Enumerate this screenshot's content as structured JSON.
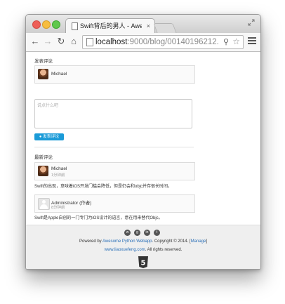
{
  "browser": {
    "tab_title": "Swift背后的男人 - Awesome",
    "tab_close": "×",
    "url_host": "localhost",
    "url_rest": ":9000/blog/00140196212...",
    "nav": {
      "back": "←",
      "forward": "→",
      "reload": "↻",
      "home": "⌂"
    },
    "zoom": "⚲",
    "star": "☆"
  },
  "page": {
    "post_comment_title": "发表评论",
    "current_user": "Michael",
    "textarea_placeholder": "说点什么吧",
    "submit_label": "发表评论",
    "latest_comments_title": "最新评论",
    "comments": [
      {
        "user": "Michael",
        "time": "1分钟前",
        "text": "Swift的出现，意味着iOS开发门槛会降低，但是仍会和objc并存很长时间。"
      },
      {
        "user": "Administrator (作者)",
        "time": "8分钟前",
        "text": "Swift是Apple自创的一门专门为iOS设计的语言，意在用来替代Objc。"
      }
    ],
    "footer": {
      "social_icons": [
        "weibo-icon",
        "github-icon",
        "linkedin-icon",
        "twitter-icon"
      ],
      "powered_prefix": "Powered by ",
      "powered_link": "Awesome Python Webapp",
      "copyright": ". Copyright © 2014. [",
      "manage_link": "Manage",
      "manage_suffix": "]",
      "site_link": "www.liaoxuefeng.com",
      "rights": ". All rights reserved.",
      "html5_badge": "5"
    }
  },
  "colors": {
    "accent": "#1b9bd8",
    "link": "#2a6fb7"
  }
}
